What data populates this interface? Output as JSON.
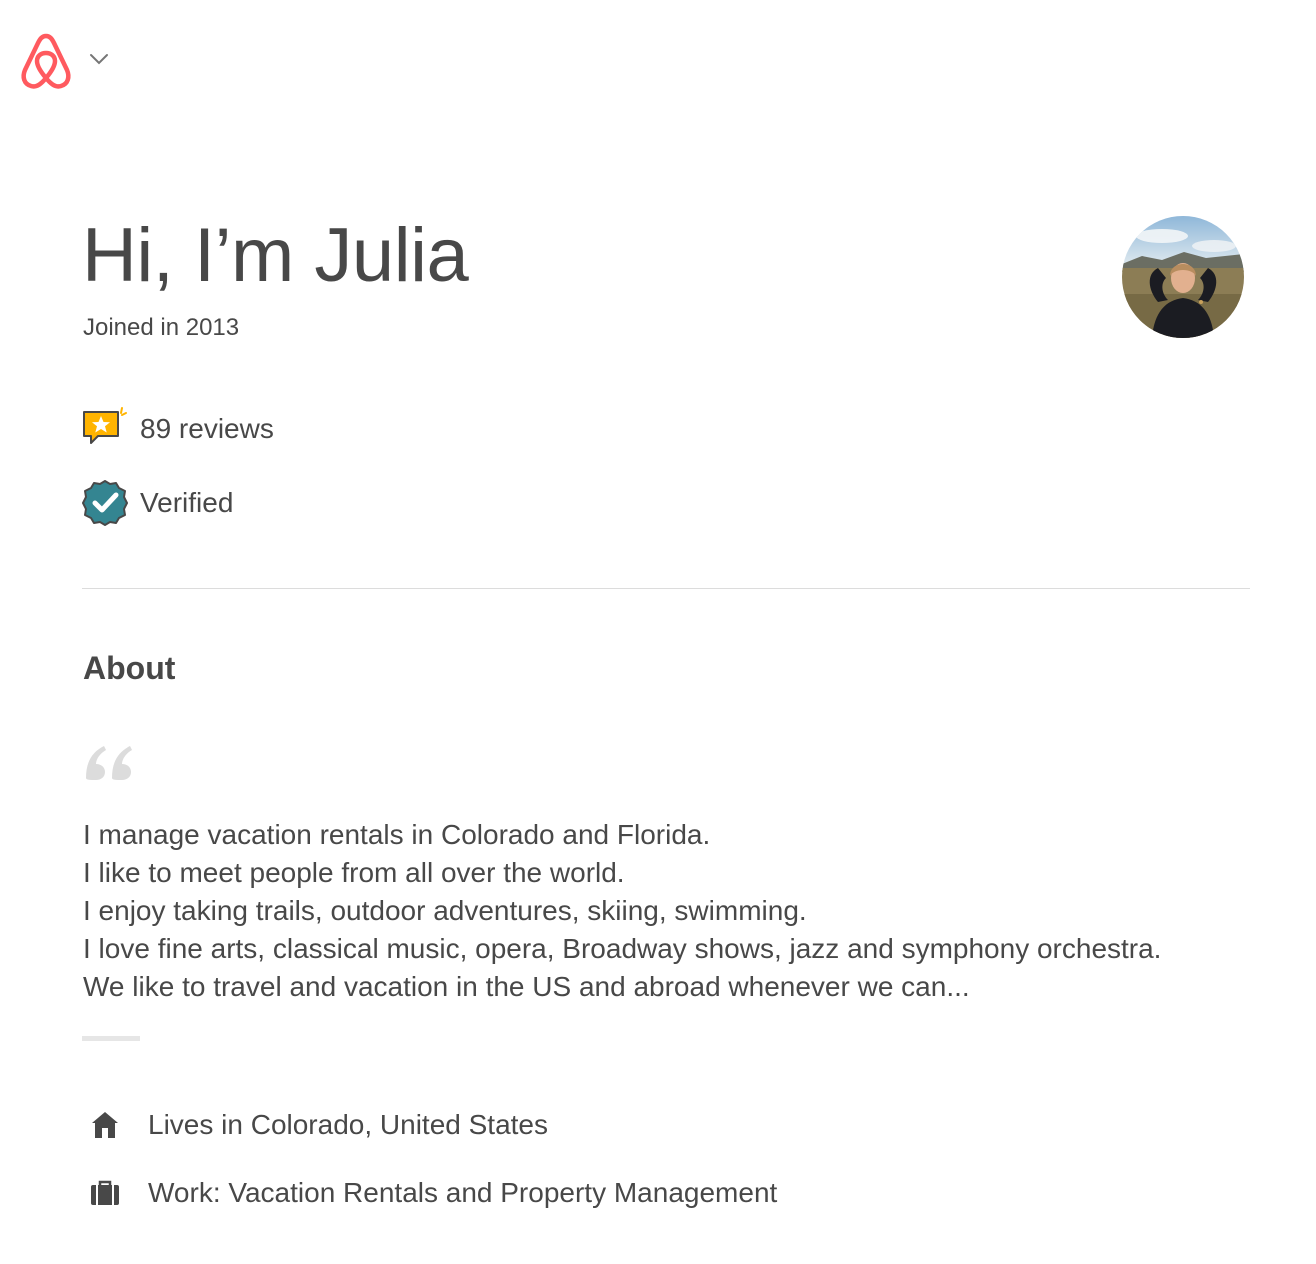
{
  "header": {
    "logo_icon": "airbnb-logo-icon",
    "menu_icon": "chevron-down-icon",
    "brand_color": "#FF5A5F"
  },
  "profile": {
    "greeting": "Hi, I’m Julia",
    "joined": "Joined in 2013",
    "avatar_icon": "user-avatar"
  },
  "badges": {
    "reviews": {
      "icon": "reviews-star-icon",
      "label": "89 reviews",
      "color": "#FFB400"
    },
    "verified": {
      "icon": "verified-check-icon",
      "label": "Verified",
      "color": "#348591"
    }
  },
  "about": {
    "heading": "About",
    "quote_icon": "quote-icon",
    "text": " I manage vacation rentals in Colorado and Florida.\nI like to meet people from all over the world.\nI enjoy taking trails, outdoor adventures, skiing, swimming.\nI love fine arts,  classical music,  opera,  Broadway shows, jazz and symphony orchestra.\nWe like to travel and vacation in the US and abroad whenever we can..."
  },
  "details": {
    "lives": {
      "icon": "home-icon",
      "label": "Lives in Colorado, United States"
    },
    "work": {
      "icon": "briefcase-icon",
      "label": "Work: Vacation Rentals and Property Management"
    }
  }
}
